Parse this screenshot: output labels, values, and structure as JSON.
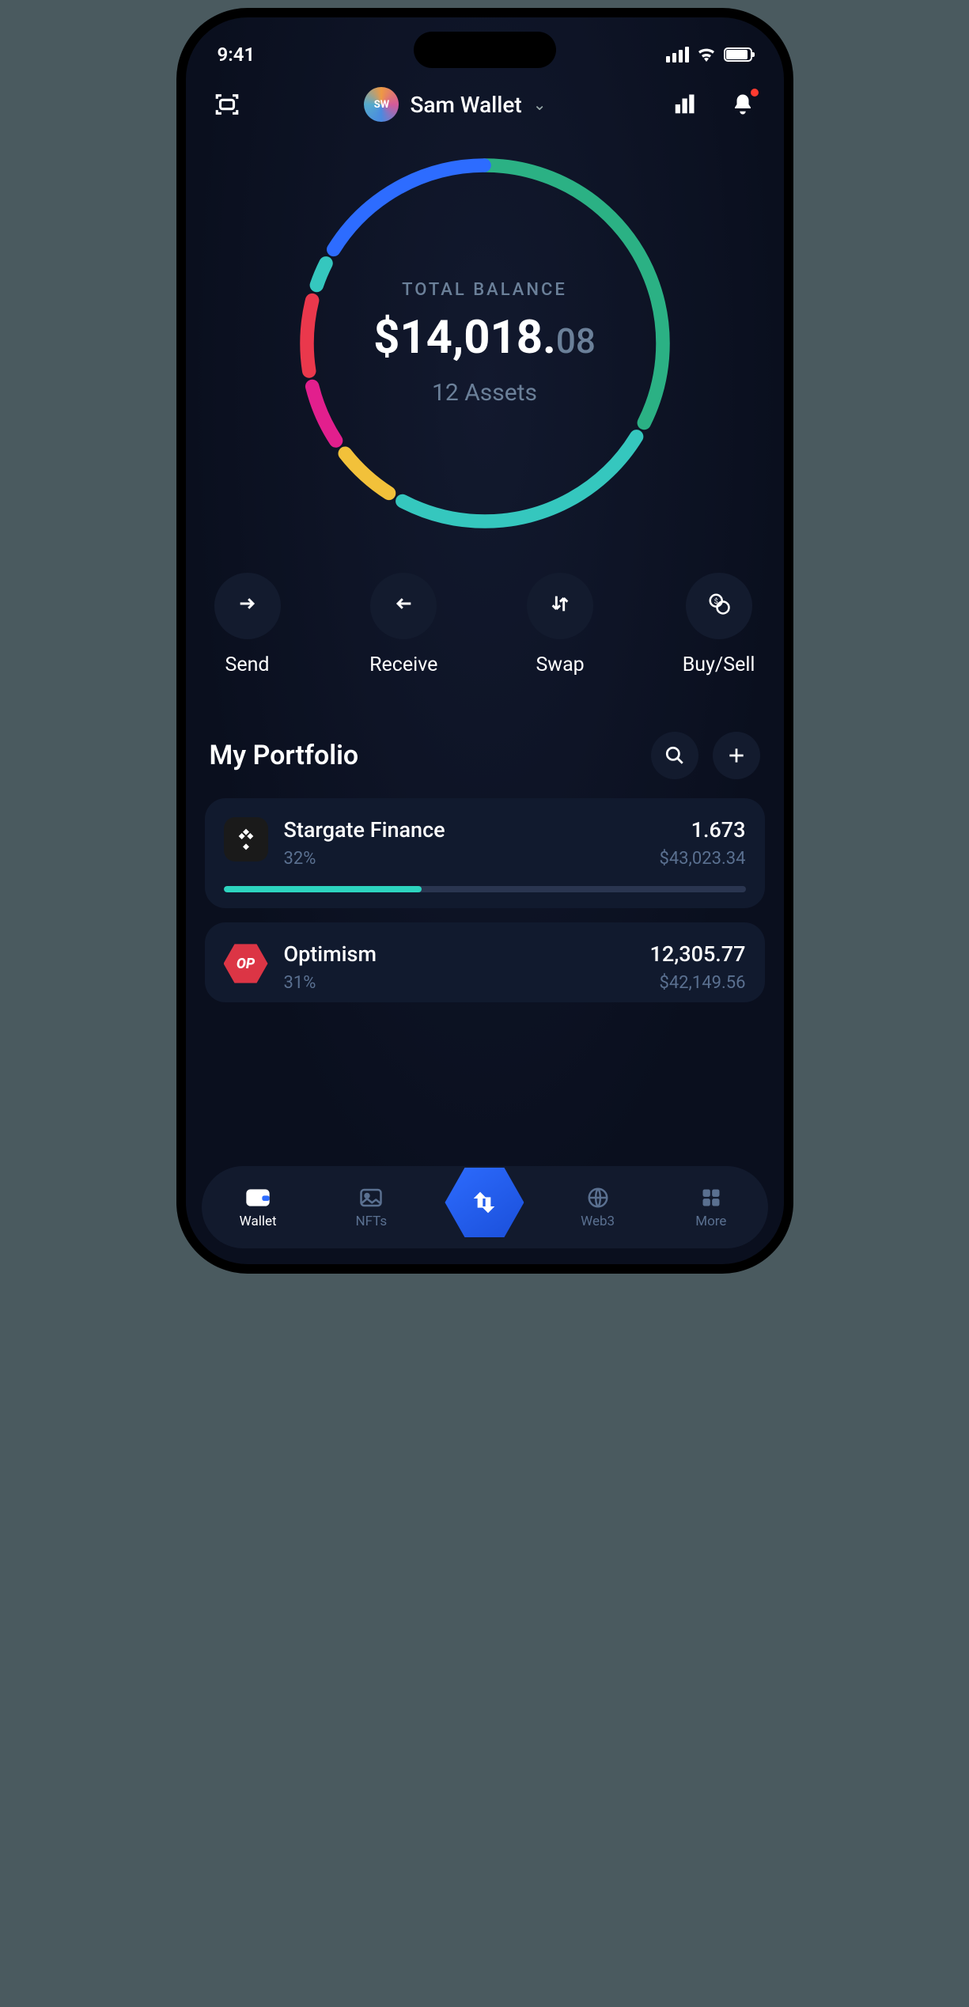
{
  "status": {
    "time": "9:41"
  },
  "header": {
    "wallet_initials": "SW",
    "wallet_name": "Sam Wallet"
  },
  "balance": {
    "label": "TOTAL BALANCE",
    "currency": "$",
    "whole": "14,018.",
    "cents": "08",
    "assets": "12 Assets"
  },
  "actions": {
    "send": "Send",
    "receive": "Receive",
    "swap": "Swap",
    "buysell": "Buy/Sell"
  },
  "portfolio": {
    "title": "My Portfolio",
    "items": [
      {
        "name": "Stargate Finance",
        "pct": "32%",
        "amount": "1.673",
        "value": "$43,023.34",
        "bar": 38
      },
      {
        "name": "Optimism",
        "pct": "31%",
        "amount": "12,305.77",
        "value": "$42,149.56",
        "bar": 0
      }
    ]
  },
  "nav": {
    "wallet": "Wallet",
    "nfts": "NFTs",
    "web3": "Web3",
    "more": "More"
  },
  "chart_data": {
    "type": "pie",
    "title": "Portfolio allocation",
    "series": [
      {
        "name": "Green (largest)",
        "values": [
          33
        ],
        "color": "#2bb184"
      },
      {
        "name": "Teal",
        "values": [
          25
        ],
        "color": "#35c7be"
      },
      {
        "name": "Yellow",
        "values": [
          6
        ],
        "color": "#f2c13a"
      },
      {
        "name": "Magenta",
        "values": [
          6
        ],
        "color": "#e21f8d"
      },
      {
        "name": "Red",
        "values": [
          7
        ],
        "color": "#ea384c"
      },
      {
        "name": "Small teal",
        "values": [
          3
        ],
        "color": "#35c7be"
      },
      {
        "name": "Blue",
        "values": [
          20
        ],
        "color": "#2d6cff"
      }
    ]
  }
}
